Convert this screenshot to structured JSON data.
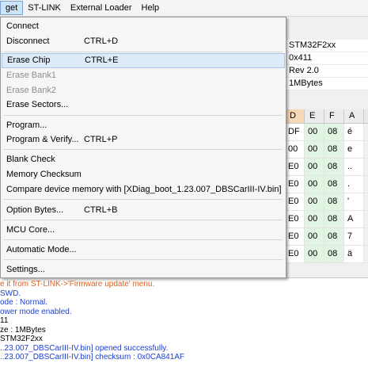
{
  "menubar": {
    "items": [
      {
        "label": "get"
      },
      {
        "label": "ST-LINK"
      },
      {
        "label": "External Loader"
      },
      {
        "label": "Help"
      }
    ]
  },
  "target_menu": {
    "items": [
      {
        "label": "Connect",
        "shortcut": ""
      },
      {
        "label": "Disconnect",
        "shortcut": "CTRL+D"
      },
      {
        "label": "Erase Chip",
        "shortcut": "CTRL+E"
      },
      {
        "label": "Erase Bank1",
        "shortcut": ""
      },
      {
        "label": "Erase Bank2",
        "shortcut": ""
      },
      {
        "label": "Erase Sectors...",
        "shortcut": ""
      },
      {
        "label": "Program...",
        "shortcut": ""
      },
      {
        "label": "Program & Verify...",
        "shortcut": "CTRL+P"
      },
      {
        "label": "Blank Check",
        "shortcut": ""
      },
      {
        "label": "Memory Checksum",
        "shortcut": ""
      },
      {
        "label": "Compare device memory with [XDiag_boot_1.23.007_DBSCarIII-IV.bin]",
        "shortcut": ""
      },
      {
        "label": "Option Bytes...",
        "shortcut": "CTRL+B"
      },
      {
        "label": "MCU Core...",
        "shortcut": ""
      },
      {
        "label": "Automatic Mode...",
        "shortcut": ""
      },
      {
        "label": "Settings...",
        "shortcut": ""
      }
    ]
  },
  "device_info": {
    "device": "STM32F2xx",
    "device_id": "0x411",
    "revision": "Rev 2.0",
    "flash_size": "1MBytes"
  },
  "memory_grid": {
    "headers": [
      "D",
      "E",
      "F",
      "A"
    ],
    "rows": [
      [
        "DF",
        "00",
        "08",
        "é"
      ],
      [
        "00",
        "00",
        "08",
        "e"
      ],
      [
        "E0",
        "00",
        "08",
        ".."
      ],
      [
        "E0",
        "00",
        "08",
        "."
      ],
      [
        "E0",
        "00",
        "08",
        "'"
      ],
      [
        "E0",
        "00",
        "08",
        "A"
      ],
      [
        "E0",
        "00",
        "08",
        "7"
      ],
      [
        "E0",
        "00",
        "08",
        "ä"
      ]
    ]
  },
  "log": {
    "lines": [
      {
        "text": "e it from ST-LINK->'Firmware update' menu.",
        "color": "#e06020"
      },
      {
        "text": "SWD.",
        "color": "#1a3fd0"
      },
      {
        "text": "ode : Normal.",
        "color": "#1a3fd0"
      },
      {
        "text": "ower mode enabled.",
        "color": "#1a3fd0"
      },
      {
        "text": "11",
        "color": "#000000"
      },
      {
        "text": "ze : 1MBytes",
        "color": "#000000"
      },
      {
        "text": "STM32F2xx",
        "color": "#000000"
      },
      {
        "text": "..23.007_DBSCarIII-IV.bin] opened successfully.",
        "color": "#1a3fd0"
      },
      {
        "text": "..23.007_DBSCarIII-IV.bin] checksum : 0x0CA841AF",
        "color": "#1a3fd0"
      }
    ]
  }
}
